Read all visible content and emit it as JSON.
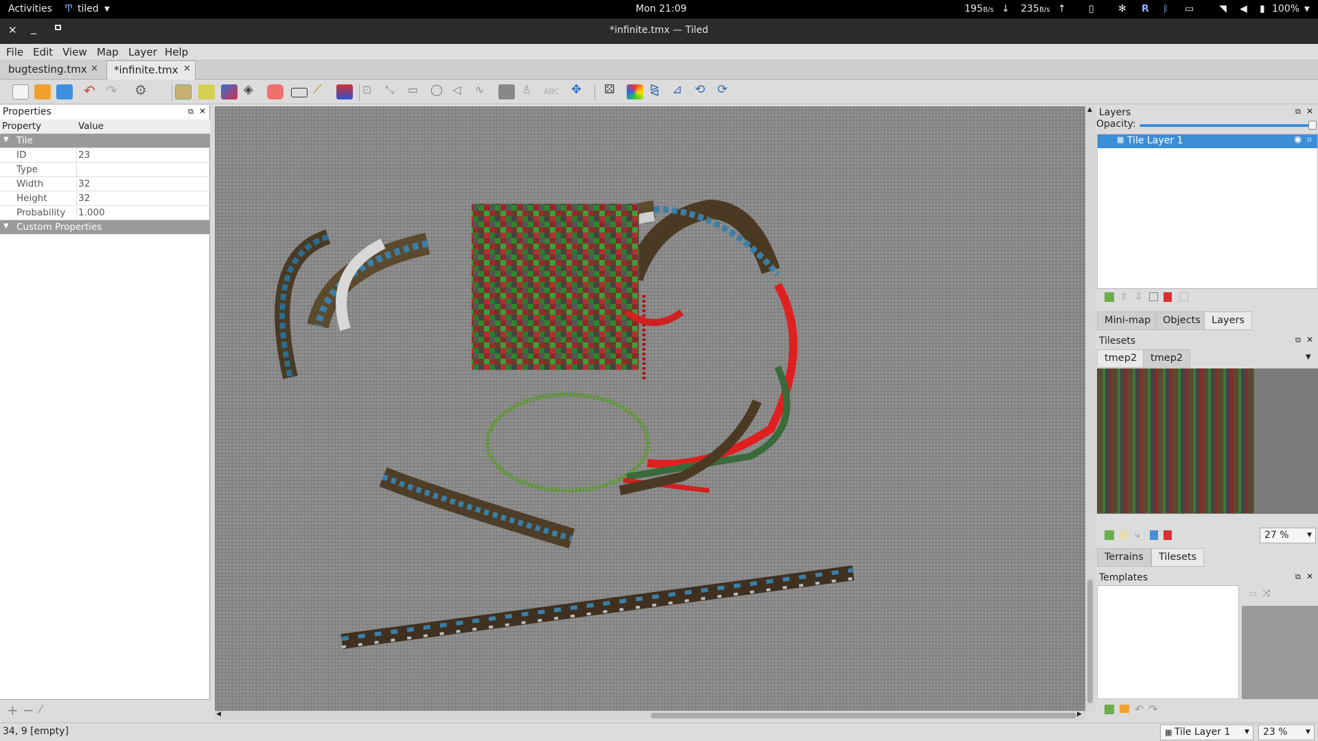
{
  "system_bar": {
    "activities": "Activities",
    "app_menu": "tiled",
    "clock": "Mon 21:09",
    "net_down": "195",
    "net_down_unit": "B/s",
    "net_up": "235",
    "net_up_unit": "B/s",
    "battery": "100%"
  },
  "window": {
    "title": "*infinite.tmx — Tiled"
  },
  "menu": [
    "File",
    "Edit",
    "View",
    "Map",
    "Layer",
    "Help"
  ],
  "tabs": [
    {
      "label": "bugtesting.tmx"
    },
    {
      "label": "*infinite.tmx"
    }
  ],
  "toolbar": {
    "icons": [
      "new-map",
      "open",
      "save",
      "undo",
      "redo",
      "commands",
      "stamp-brush",
      "terrain-brush",
      "wang-brush",
      "bucket-fill",
      "eraser",
      "rectangular-select",
      "magic-wand",
      "select-same-tile",
      "select-objects",
      "edit-polygons",
      "insert-rectangle",
      "insert-ellipse",
      "insert-polygon",
      "insert-polyline",
      "insert-tile",
      "insert-template",
      "insert-text",
      "move",
      "random-mode",
      "wang-fill",
      "flip-horizontal",
      "flip-vertical",
      "rotate-left",
      "rotate-right"
    ]
  },
  "properties": {
    "title": "Properties",
    "col_property": "Property",
    "col_value": "Value",
    "group_tile": "Tile",
    "rows": [
      {
        "key": "ID",
        "value": "23"
      },
      {
        "key": "Type",
        "value": ""
      },
      {
        "key": "Width",
        "value": "32"
      },
      {
        "key": "Height",
        "value": "32"
      },
      {
        "key": "Probability",
        "value": "1.000"
      }
    ],
    "group_custom": "Custom Properties"
  },
  "layers": {
    "title": "Layers",
    "opacity_label": "Opacity:",
    "opacity": 1.0,
    "items": [
      {
        "name": "Tile Layer 1",
        "selected": true,
        "visible": true
      }
    ]
  },
  "dock_tabs_1": [
    {
      "label": "Mini-map"
    },
    {
      "label": "Objects"
    },
    {
      "label": "Layers"
    }
  ],
  "tilesets": {
    "title": "Tilesets",
    "tabs": [
      {
        "label": "tmep2"
      },
      {
        "label": "tmep2"
      }
    ],
    "zoom": "27 %"
  },
  "dock_tabs_2": [
    {
      "label": "Terrains"
    },
    {
      "label": "Tilesets"
    }
  ],
  "templates": {
    "title": "Templates"
  },
  "status": {
    "coords": "34, 9 [empty]",
    "layer_select": "Tile Layer 1",
    "zoom": "23 %"
  },
  "colors": {
    "accent": "#3b8ed8",
    "canvas_bg": "#909090",
    "grid": "#7c7c7c",
    "dark_bar": "#2b2b2b"
  }
}
